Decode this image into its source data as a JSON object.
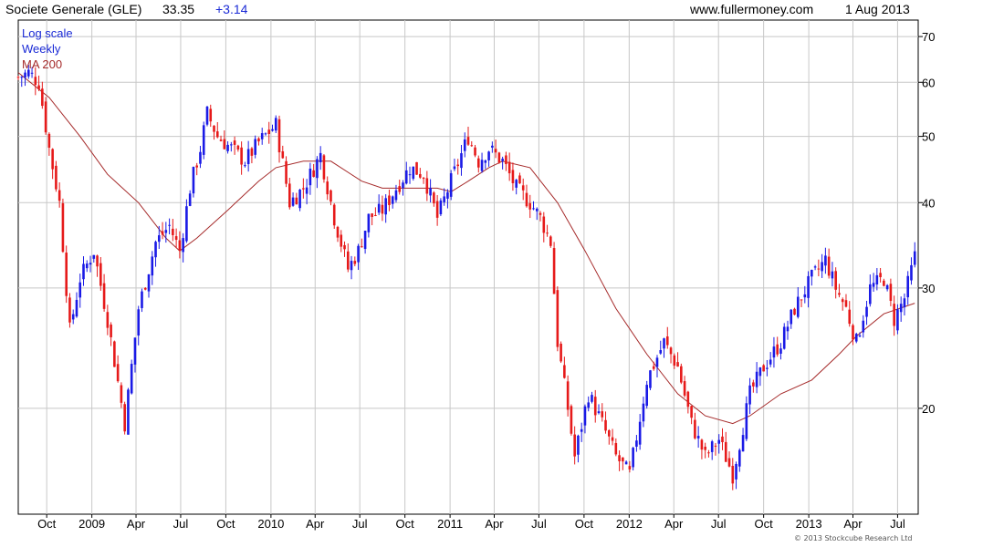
{
  "header": {
    "title": "Societe Generale (GLE)",
    "price": "33.35",
    "change": "+3.14",
    "site": "www.fullermoney.com",
    "date": "1 Aug 2013"
  },
  "legend": [
    {
      "label": "Log scale",
      "color": "#1a2ad6"
    },
    {
      "label": "Weekly",
      "color": "#1a2ad6"
    },
    {
      "label": "MA 200",
      "color": "#a52a2a"
    }
  ],
  "copyright": "© 2013 Stockcube Research Ltd",
  "colors": {
    "up": "#1a1ae6",
    "down": "#e61a1a",
    "ma": "#a52a2a",
    "grid": "#c8c8c8"
  },
  "chart_data": {
    "type": "candlestick",
    "scale": "log",
    "ylim": [
      14,
      74
    ],
    "y_ticks": [
      20,
      30,
      40,
      50,
      60,
      70
    ],
    "x_ticks": [
      {
        "label": "Oct",
        "date": "2008-10-01"
      },
      {
        "label": "2009",
        "date": "2009-01-01"
      },
      {
        "label": "Apr",
        "date": "2009-04-01"
      },
      {
        "label": "Jul",
        "date": "2009-07-01"
      },
      {
        "label": "Oct",
        "date": "2009-10-01"
      },
      {
        "label": "2010",
        "date": "2010-01-01"
      },
      {
        "label": "Apr",
        "date": "2010-04-01"
      },
      {
        "label": "Jul",
        "date": "2010-07-01"
      },
      {
        "label": "Oct",
        "date": "2010-10-01"
      },
      {
        "label": "2011",
        "date": "2011-01-01"
      },
      {
        "label": "Apr",
        "date": "2011-04-01"
      },
      {
        "label": "Jul",
        "date": "2011-07-01"
      },
      {
        "label": "Oct",
        "date": "2011-10-01"
      },
      {
        "label": "2012",
        "date": "2012-01-01"
      },
      {
        "label": "Apr",
        "date": "2012-04-01"
      },
      {
        "label": "Jul",
        "date": "2012-07-01"
      },
      {
        "label": "Oct",
        "date": "2012-10-01"
      },
      {
        "label": "2013",
        "date": "2013-01-01"
      },
      {
        "label": "Apr",
        "date": "2013-04-01"
      },
      {
        "label": "Jul",
        "date": "2013-07-01"
      }
    ],
    "x_range": [
      "2008-08-04",
      "2013-08-12"
    ],
    "price_path": [
      [
        "2008-08-04",
        61
      ],
      [
        "2008-08-25",
        62
      ],
      [
        "2008-09-15",
        60
      ],
      [
        "2008-10-06",
        48
      ],
      [
        "2008-10-27",
        40
      ],
      [
        "2008-11-17",
        26
      ],
      [
        "2008-12-08",
        31
      ],
      [
        "2009-01-05",
        34
      ],
      [
        "2009-02-02",
        27
      ],
      [
        "2009-03-09",
        19
      ],
      [
        "2009-04-06",
        28
      ],
      [
        "2009-05-11",
        35
      ],
      [
        "2009-06-08",
        37
      ],
      [
        "2009-06-29",
        34
      ],
      [
        "2009-07-20",
        42
      ],
      [
        "2009-08-10",
        48
      ],
      [
        "2009-08-24",
        54
      ],
      [
        "2009-09-14",
        50
      ],
      [
        "2009-10-12",
        48
      ],
      [
        "2009-11-09",
        46
      ],
      [
        "2009-12-07",
        49
      ],
      [
        "2010-01-11",
        52
      ],
      [
        "2010-02-08",
        40
      ],
      [
        "2010-03-08",
        42
      ],
      [
        "2010-04-12",
        47
      ],
      [
        "2010-05-10",
        38
      ],
      [
        "2010-06-07",
        32
      ],
      [
        "2010-06-28",
        34
      ],
      [
        "2010-07-19",
        38
      ],
      [
        "2010-08-16",
        39
      ],
      [
        "2010-09-13",
        42
      ],
      [
        "2010-10-11",
        45
      ],
      [
        "2010-11-08",
        44
      ],
      [
        "2010-12-06",
        38
      ],
      [
        "2011-01-03",
        43
      ],
      [
        "2011-02-07",
        50
      ],
      [
        "2011-02-28",
        46
      ],
      [
        "2011-03-21",
        48
      ],
      [
        "2011-04-18",
        46
      ],
      [
        "2011-05-16",
        42
      ],
      [
        "2011-06-13",
        40
      ],
      [
        "2011-07-04",
        38
      ],
      [
        "2011-07-25",
        35
      ],
      [
        "2011-08-08",
        25
      ],
      [
        "2011-08-29",
        20
      ],
      [
        "2011-09-12",
        17
      ],
      [
        "2011-10-10",
        21
      ],
      [
        "2011-11-07",
        19
      ],
      [
        "2011-12-05",
        17
      ],
      [
        "2012-01-02",
        16
      ],
      [
        "2012-02-06",
        22
      ],
      [
        "2012-03-12",
        25
      ],
      [
        "2012-04-09",
        23
      ],
      [
        "2012-05-07",
        19
      ],
      [
        "2012-06-04",
        17
      ],
      [
        "2012-07-02",
        18
      ],
      [
        "2012-07-30",
        16
      ],
      [
        "2012-09-03",
        21
      ],
      [
        "2012-10-01",
        23
      ],
      [
        "2012-11-05",
        25
      ],
      [
        "2012-12-03",
        28
      ],
      [
        "2013-01-07",
        31
      ],
      [
        "2013-02-04",
        33
      ],
      [
        "2013-02-25",
        30
      ],
      [
        "2013-03-18",
        28
      ],
      [
        "2013-04-08",
        25
      ],
      [
        "2013-05-06",
        30
      ],
      [
        "2013-06-03",
        31
      ],
      [
        "2013-06-24",
        27
      ],
      [
        "2013-07-15",
        29
      ],
      [
        "2013-08-05",
        33.35
      ]
    ],
    "ma_path": [
      [
        "2008-08-04",
        62
      ],
      [
        "2008-10-06",
        57
      ],
      [
        "2008-12-08",
        50
      ],
      [
        "2009-02-02",
        44
      ],
      [
        "2009-04-06",
        40
      ],
      [
        "2009-06-01",
        35.5
      ],
      [
        "2009-06-29",
        34
      ],
      [
        "2009-08-03",
        35.5
      ],
      [
        "2009-10-05",
        39
      ],
      [
        "2009-12-07",
        43
      ],
      [
        "2010-01-11",
        45
      ],
      [
        "2010-03-08",
        46
      ],
      [
        "2010-05-03",
        46
      ],
      [
        "2010-07-05",
        43
      ],
      [
        "2010-08-16",
        42
      ],
      [
        "2010-10-04",
        42
      ],
      [
        "2010-12-06",
        42
      ],
      [
        "2011-01-03",
        41.5
      ],
      [
        "2011-02-07",
        43
      ],
      [
        "2011-03-21",
        45
      ],
      [
        "2011-04-18",
        46
      ],
      [
        "2011-06-13",
        45
      ],
      [
        "2011-08-08",
        40
      ],
      [
        "2011-10-03",
        34
      ],
      [
        "2011-12-05",
        28
      ],
      [
        "2012-02-06",
        24
      ],
      [
        "2012-04-09",
        21
      ],
      [
        "2012-06-04",
        19.5
      ],
      [
        "2012-07-30",
        19
      ],
      [
        "2012-09-03",
        19.5
      ],
      [
        "2012-11-05",
        21
      ],
      [
        "2013-01-07",
        22
      ],
      [
        "2013-03-04",
        24
      ],
      [
        "2013-04-08",
        25.5
      ],
      [
        "2013-06-03",
        27.5
      ],
      [
        "2013-08-05",
        28.5
      ]
    ]
  }
}
